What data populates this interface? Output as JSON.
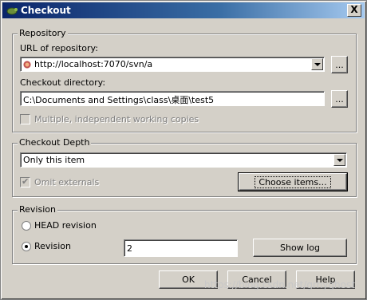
{
  "window": {
    "title": "Checkout",
    "close": "X"
  },
  "repository": {
    "group_label": "Repository",
    "url_label": "URL of repository:",
    "url_value": "http://localhost:7070/svn/a",
    "browse_label": "...",
    "dir_label": "Checkout directory:",
    "dir_value": "C:\\Documents and Settings\\class\\桌面\\test5",
    "dir_browse_label": "...",
    "multiple_label": "Multiple, independent working copies"
  },
  "depth": {
    "group_label": "Checkout Depth",
    "selected": "Only this item",
    "omit_externals_label": "Omit externals",
    "choose_items_label": "Choose items..."
  },
  "revision": {
    "group_label": "Revision",
    "head_label": "HEAD revision",
    "revision_label": "Revision",
    "revision_value": "2",
    "show_log_label": "Show log"
  },
  "buttons": {
    "ok": "OK",
    "cancel": "Cancel",
    "help": "Help"
  },
  "watermark": "https://blog.csdn.net/grhyghost"
}
